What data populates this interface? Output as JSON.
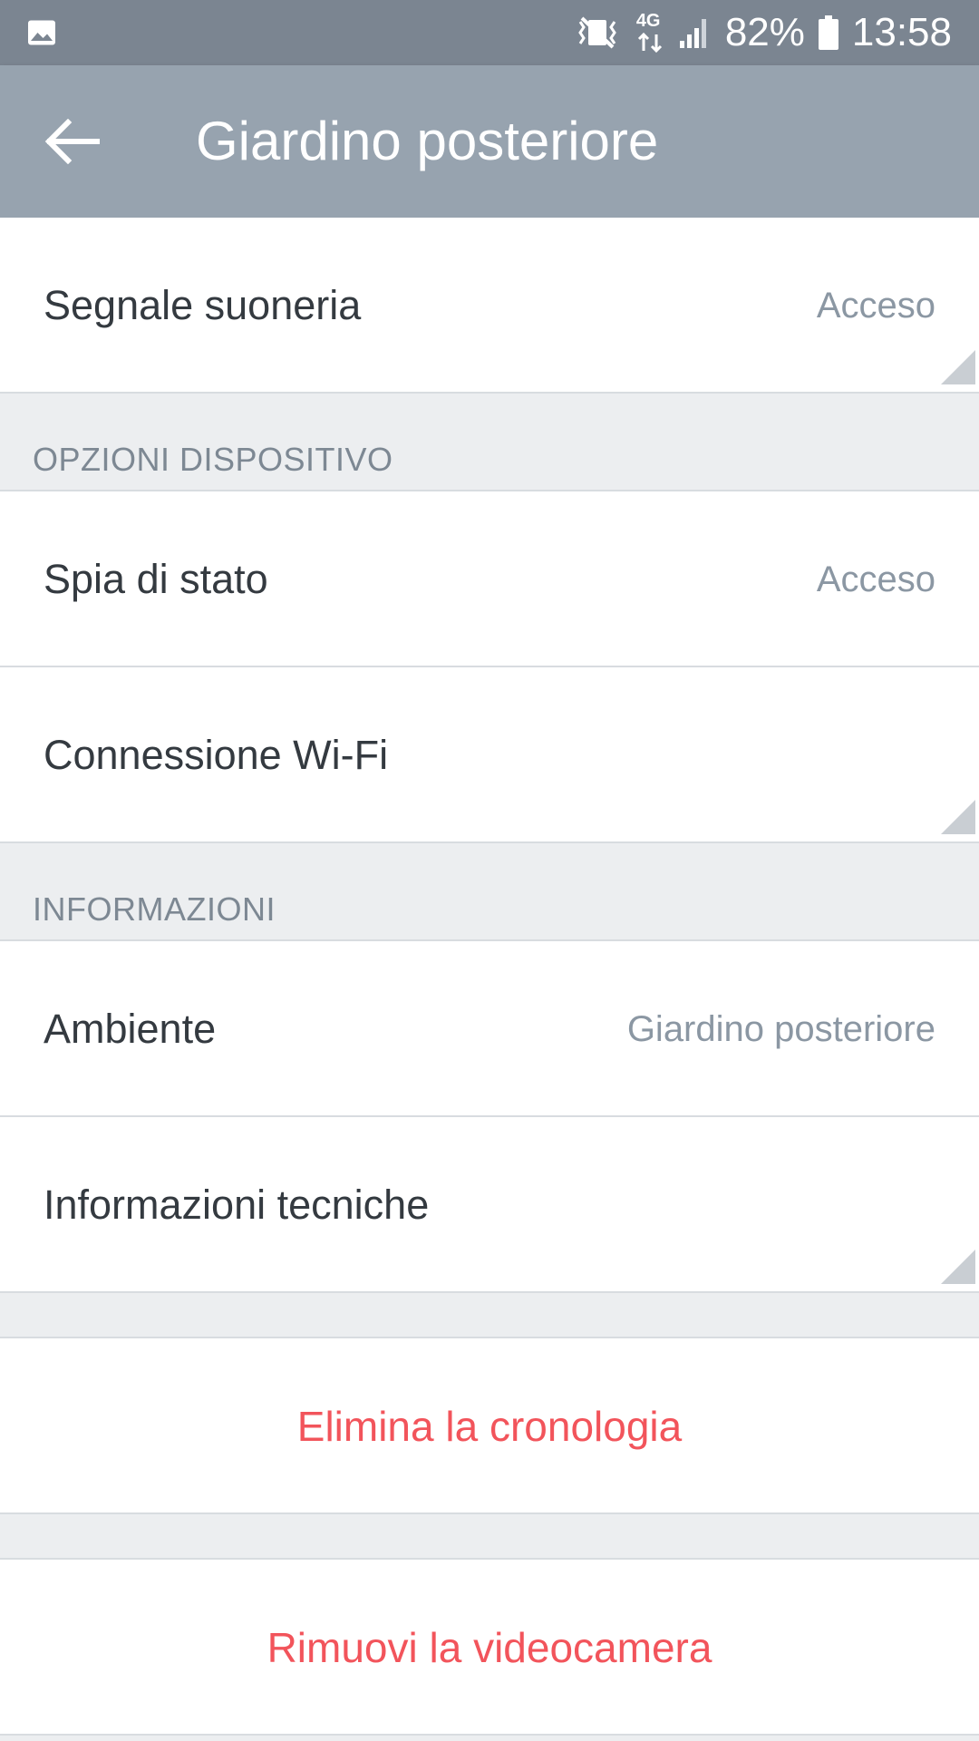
{
  "status_bar": {
    "battery": "82%",
    "time": "13:58",
    "network": "4G",
    "icons": [
      "gallery-icon",
      "vibrate-icon",
      "data-arrows-icon",
      "signal-icon",
      "battery-icon"
    ]
  },
  "app_bar": {
    "title": "Giardino posteriore",
    "back_icon": "arrow-left-icon"
  },
  "rows": {
    "ring_signal": {
      "label": "Segnale suoneria",
      "value": "Acceso"
    },
    "status_light": {
      "label": "Spia di stato",
      "value": "Acceso"
    },
    "wifi": {
      "label": "Connessione Wi-Fi"
    },
    "room": {
      "label": "Ambiente",
      "value": "Giardino posteriore"
    },
    "tech_info": {
      "label": "Informazioni tecniche"
    }
  },
  "sections": {
    "device_options": "OPZIONI DISPOSITIVO",
    "information": "INFORMAZIONI"
  },
  "actions": {
    "clear_history": "Elimina la cronologia",
    "remove_camera": "Rimuovi la videocamera"
  },
  "colors": {
    "status_bar": "#7b8591",
    "app_bar": "#97a3af",
    "danger": "#f2545b",
    "value_text": "#8b97a3"
  }
}
